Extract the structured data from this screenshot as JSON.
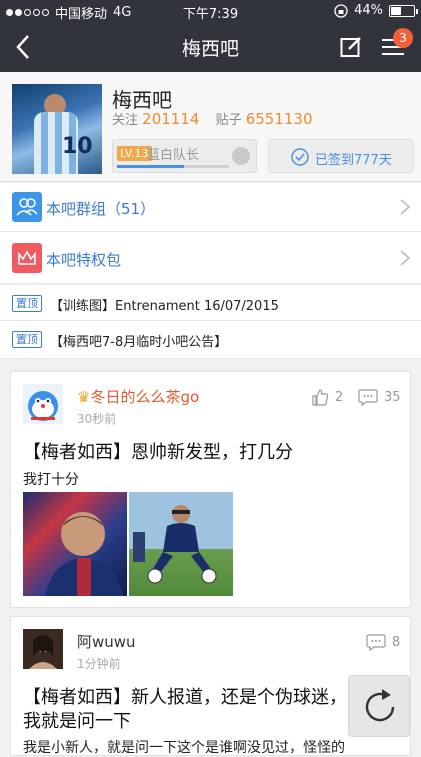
{
  "status": {
    "carrier": "中国移动",
    "network": "4G",
    "time": "下午7:39",
    "battery": "44%",
    "signal_filled": 2,
    "signal_total": 5,
    "battery_fraction": 0.44
  },
  "nav": {
    "title": "梅西吧",
    "badge": "3",
    "color": "#31343b",
    "badge_color": "#f25f38"
  },
  "header": {
    "name": "梅西吧",
    "follow_label": "关注",
    "follow_count": "201114",
    "posts_label": "贴子",
    "posts_count": "6551130",
    "level": "LV.13",
    "rank": "蓝白队长",
    "progress": 0.6,
    "signed": "已签到777天",
    "accent": "#f28a30",
    "blue": "#4b8fe0"
  },
  "links": [
    {
      "label": "本吧群组（51）",
      "icon": "group-icon"
    },
    {
      "label": "本吧特权包",
      "icon": "crown-icon"
    }
  ],
  "pinned": [
    {
      "tag": "置顶",
      "text": "【训练图】Entrenament 16/07/2015"
    },
    {
      "tag": "置顶",
      "text": "【梅西吧7-8月临时小吧公告】"
    }
  ],
  "posts": [
    {
      "user": "冬日的么么茶go",
      "time": "30秒前",
      "likes": "2",
      "comments": "35",
      "title": "【梅者如西】恩帅新发型，打几分",
      "body": "我打十分"
    },
    {
      "user": "阿wuwu",
      "time": "1分钟前",
      "comments": "8",
      "title": "【梅者如西】新人报道，还是个伪球迷，",
      "title2": "我就是问一下",
      "body": "我是小新人，就是问一下这个是谁啊没见过，怪怪的"
    }
  ]
}
